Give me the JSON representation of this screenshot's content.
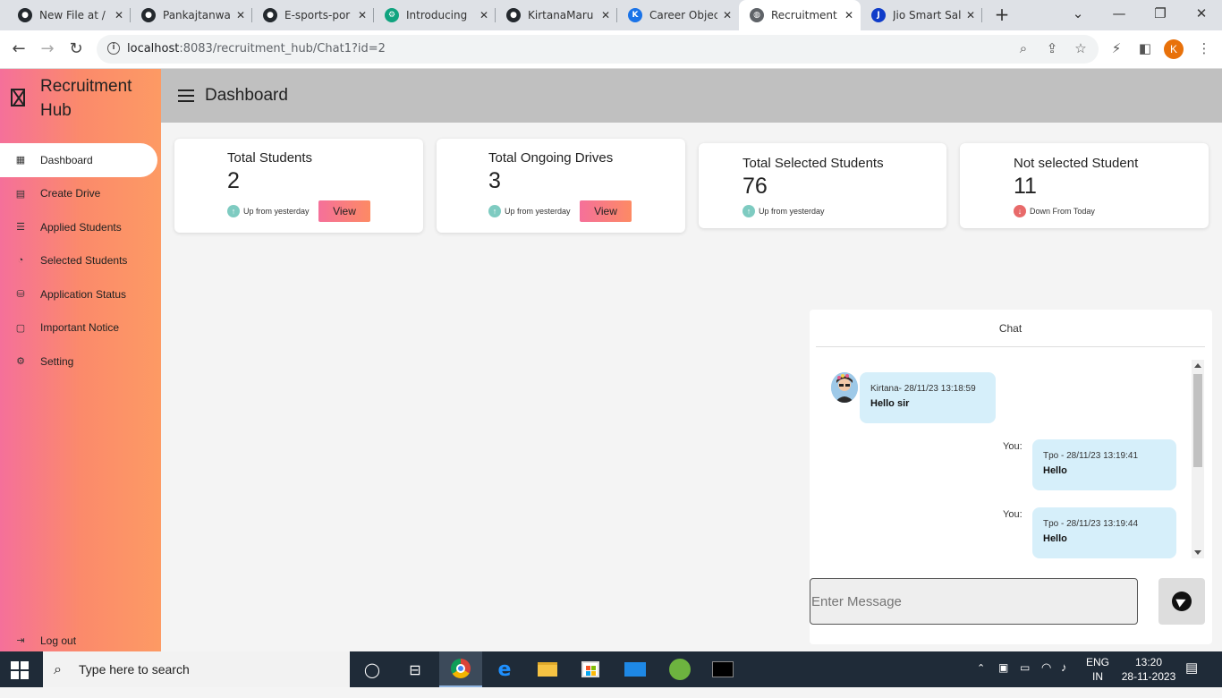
{
  "browser": {
    "tabs": [
      {
        "title": "New File at /",
        "icon": "github-icon",
        "color": "#24292e"
      },
      {
        "title": "Pankajtanwar",
        "icon": "github-icon",
        "color": "#24292e"
      },
      {
        "title": "E-sports-por",
        "icon": "github-icon",
        "color": "#24292e"
      },
      {
        "title": "Introducing",
        "icon": "chatgpt-icon",
        "color": "#10a37f"
      },
      {
        "title": "KirtanaMaru",
        "icon": "github-icon",
        "color": "#24292e"
      },
      {
        "title": "Career Objec",
        "icon": "kodeclik-icon",
        "color": "#1a73e8"
      },
      {
        "title": "Recruitment",
        "icon": "globe-icon",
        "color": "#5f6368"
      },
      {
        "title": "Jio Smart Sal",
        "icon": "jio-icon",
        "color": "#0f3cc9"
      }
    ],
    "new_tab": "+",
    "url_host": "localhost",
    "url_rest": ":8083/recruitment_hub/Chat1?id=2",
    "profile_initial": "K"
  },
  "app": {
    "brand_line1": "Recruitment",
    "brand_line2": "Hub",
    "page_title": "Dashboard",
    "nav": [
      {
        "label": "Dashboard",
        "icon": "grid-icon"
      },
      {
        "label": "Create Drive",
        "icon": "calendar-icon"
      },
      {
        "label": "Applied Students",
        "icon": "list-icon"
      },
      {
        "label": "Selected Students",
        "icon": "pie-icon"
      },
      {
        "label": "Application Status",
        "icon": "database-icon"
      },
      {
        "label": "Important Notice",
        "icon": "message-icon"
      },
      {
        "label": "Setting",
        "icon": "gear-icon"
      }
    ],
    "logout": "Log out"
  },
  "cards": [
    {
      "title": "Total Students",
      "value": "2",
      "trend": "Up from yesterday",
      "direction": "up",
      "button": "View"
    },
    {
      "title": "Total Ongoing Drives",
      "value": "3",
      "trend": "Up from yesterday",
      "direction": "up",
      "button": "View"
    },
    {
      "title": "Total Selected Students",
      "value": "76",
      "trend": "Up from yesterday",
      "direction": "up"
    },
    {
      "title": "Not selected Student",
      "value": "11",
      "trend": "Down From Today",
      "direction": "down"
    }
  ],
  "chat": {
    "header": "Chat",
    "messages": [
      {
        "meta": "Kirtana- 28/11/23 13:18:59",
        "text": "Hello sir",
        "side": "left"
      },
      {
        "label": "You:",
        "meta": "Tpo - 28/11/23 13:19:41",
        "text": "Hello",
        "side": "right"
      },
      {
        "label": "You:",
        "meta": "Tpo - 28/11/23 13:19:44",
        "text": "Hello",
        "side": "right"
      }
    ],
    "input_placeholder": "Enter Message"
  },
  "taskbar": {
    "search_placeholder": "Type here to search",
    "lang_top": "ENG",
    "lang_bottom": "IN",
    "time": "13:20",
    "date": "28-11-2023"
  },
  "colors": {
    "up": "#7ecbc1",
    "down": "#e86a6a",
    "accent_start": "#f5709a",
    "accent_end": "#fd9a64"
  }
}
